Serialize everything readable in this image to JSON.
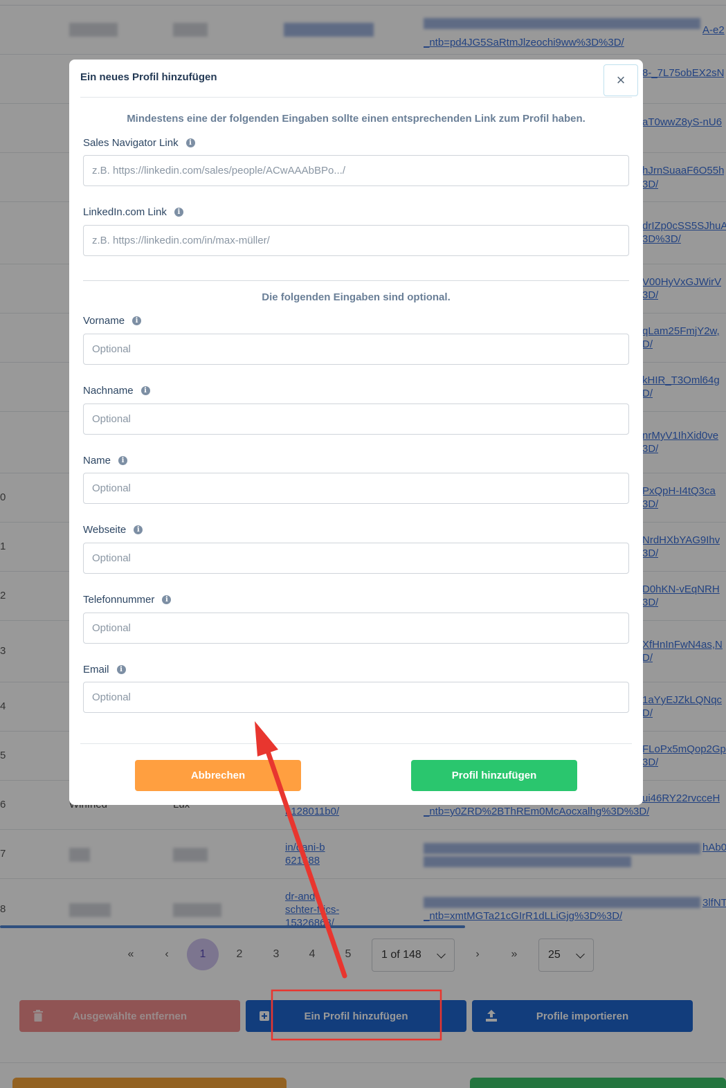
{
  "modal": {
    "title": "Ein neues Profil hinzufügen",
    "close_symbol": "×",
    "intro": "Mindestens eine der folgenden Eingaben sollte einen entsprechenden Link zum Profil haben.",
    "optional_note": "Die folgenden Eingaben sind optional.",
    "fields": [
      {
        "label": "Sales Navigator Link",
        "placeholder": "z.B. https://linkedin.com/sales/people/ACwAAAbBPo.../"
      },
      {
        "label": "LinkedIn.com Link",
        "placeholder": "z.B. https://linkedin.com/in/max-müller/"
      },
      {
        "label": "Vorname",
        "placeholder": "Optional"
      },
      {
        "label": "Nachname",
        "placeholder": "Optional"
      },
      {
        "label": "Name",
        "placeholder": "Optional"
      },
      {
        "label": "Webseite",
        "placeholder": "Optional"
      },
      {
        "label": "Telefonnummer",
        "placeholder": "Optional"
      },
      {
        "label": "Email",
        "placeholder": "Optional"
      }
    ],
    "info_symbol": "i",
    "cancel_label": "Abbrechen",
    "submit_label": "Profil hinzufügen"
  },
  "table": {
    "row_numbers": [
      "0",
      "1",
      "2",
      "3",
      "4",
      "5",
      "6",
      "7",
      "8"
    ],
    "right_links": [
      {
        "l1": "A-e2",
        "l2": "_ntb=pd4JG5SaRtmJlzeochi9ww%3D%3D/"
      },
      {
        "l1": "8-_7L75obEX2sN",
        "l2": ""
      },
      {
        "l1": "aT0wwZ8yS-nU6",
        "l2": ""
      },
      {
        "l1": "hJrnSuaaF6O55h",
        "l2": "3D/"
      },
      {
        "l1": "drIZp0cSS5SJhuA",
        "l2": "3D%3D/"
      },
      {
        "l1": "V00HyVxGJWirV",
        "l2": "3D/"
      },
      {
        "l1": "qLam25FmjY2w,",
        "l2": "D/"
      },
      {
        "l1": "kHIR_T3Oml64g",
        "l2": "D/"
      },
      {
        "l1": "nrMyV1IhXid0ve",
        "l2": "3D/"
      },
      {
        "l1": "PxQpH-I4tQ3ca",
        "l2": "3D/"
      },
      {
        "l1": "NrdHXbYAG9Ihv",
        "l2": "3D/"
      },
      {
        "l1": "D0hKN-vEqNRH",
        "l2": "3D/"
      },
      {
        "l1": "XfHnInFwN4as,N",
        "l2": "D/"
      },
      {
        "l1": "1aYyEJZkLQNqc",
        "l2": "D/"
      },
      {
        "l1": "FLoPx5mQop2Gp",
        "l2": "3D/"
      },
      {
        "l1": "ui46RY22rvcceH",
        "l2": "_ntb=y0ZRD%2BThREm0McAocxalhg%3D%3D/"
      },
      {
        "l1": "hAb0",
        "l2": ""
      },
      {
        "l1": "3lfNT",
        "l2": "_ntb=xmtMGTa21cGIrR1dLLiGjg%3D%3D/"
      }
    ],
    "visible_cells": {
      "first_name_row6": "Winfried",
      "last_name_row6": "Lux",
      "linkedin_row6": "b128011b0/",
      "linkedin_row7_a": "in/dani-b",
      "linkedin_row7_b": "621588",
      "linkedin_row8_a": "dr-and",
      "linkedin_row8_b": "schter-frics-",
      "linkedin_row8_c": "15326863/"
    }
  },
  "pagination": {
    "first": "«",
    "prev": "‹",
    "pages": [
      "1",
      "2",
      "3",
      "4",
      "5"
    ],
    "active_page": "1",
    "page_select": "1 of 148",
    "next": "›",
    "last": "»",
    "page_size": "25"
  },
  "actions": {
    "remove_label": "Ausgewählte entfernen",
    "add_label": "Ein Profil hinzufügen",
    "import_label": "Profile importieren"
  },
  "colors": {
    "primary": "#1f66cf",
    "danger_disabled": "#f08d8d",
    "cancel": "#ff9f40",
    "submit": "#2ac66e",
    "annotation": "#e8362f"
  }
}
